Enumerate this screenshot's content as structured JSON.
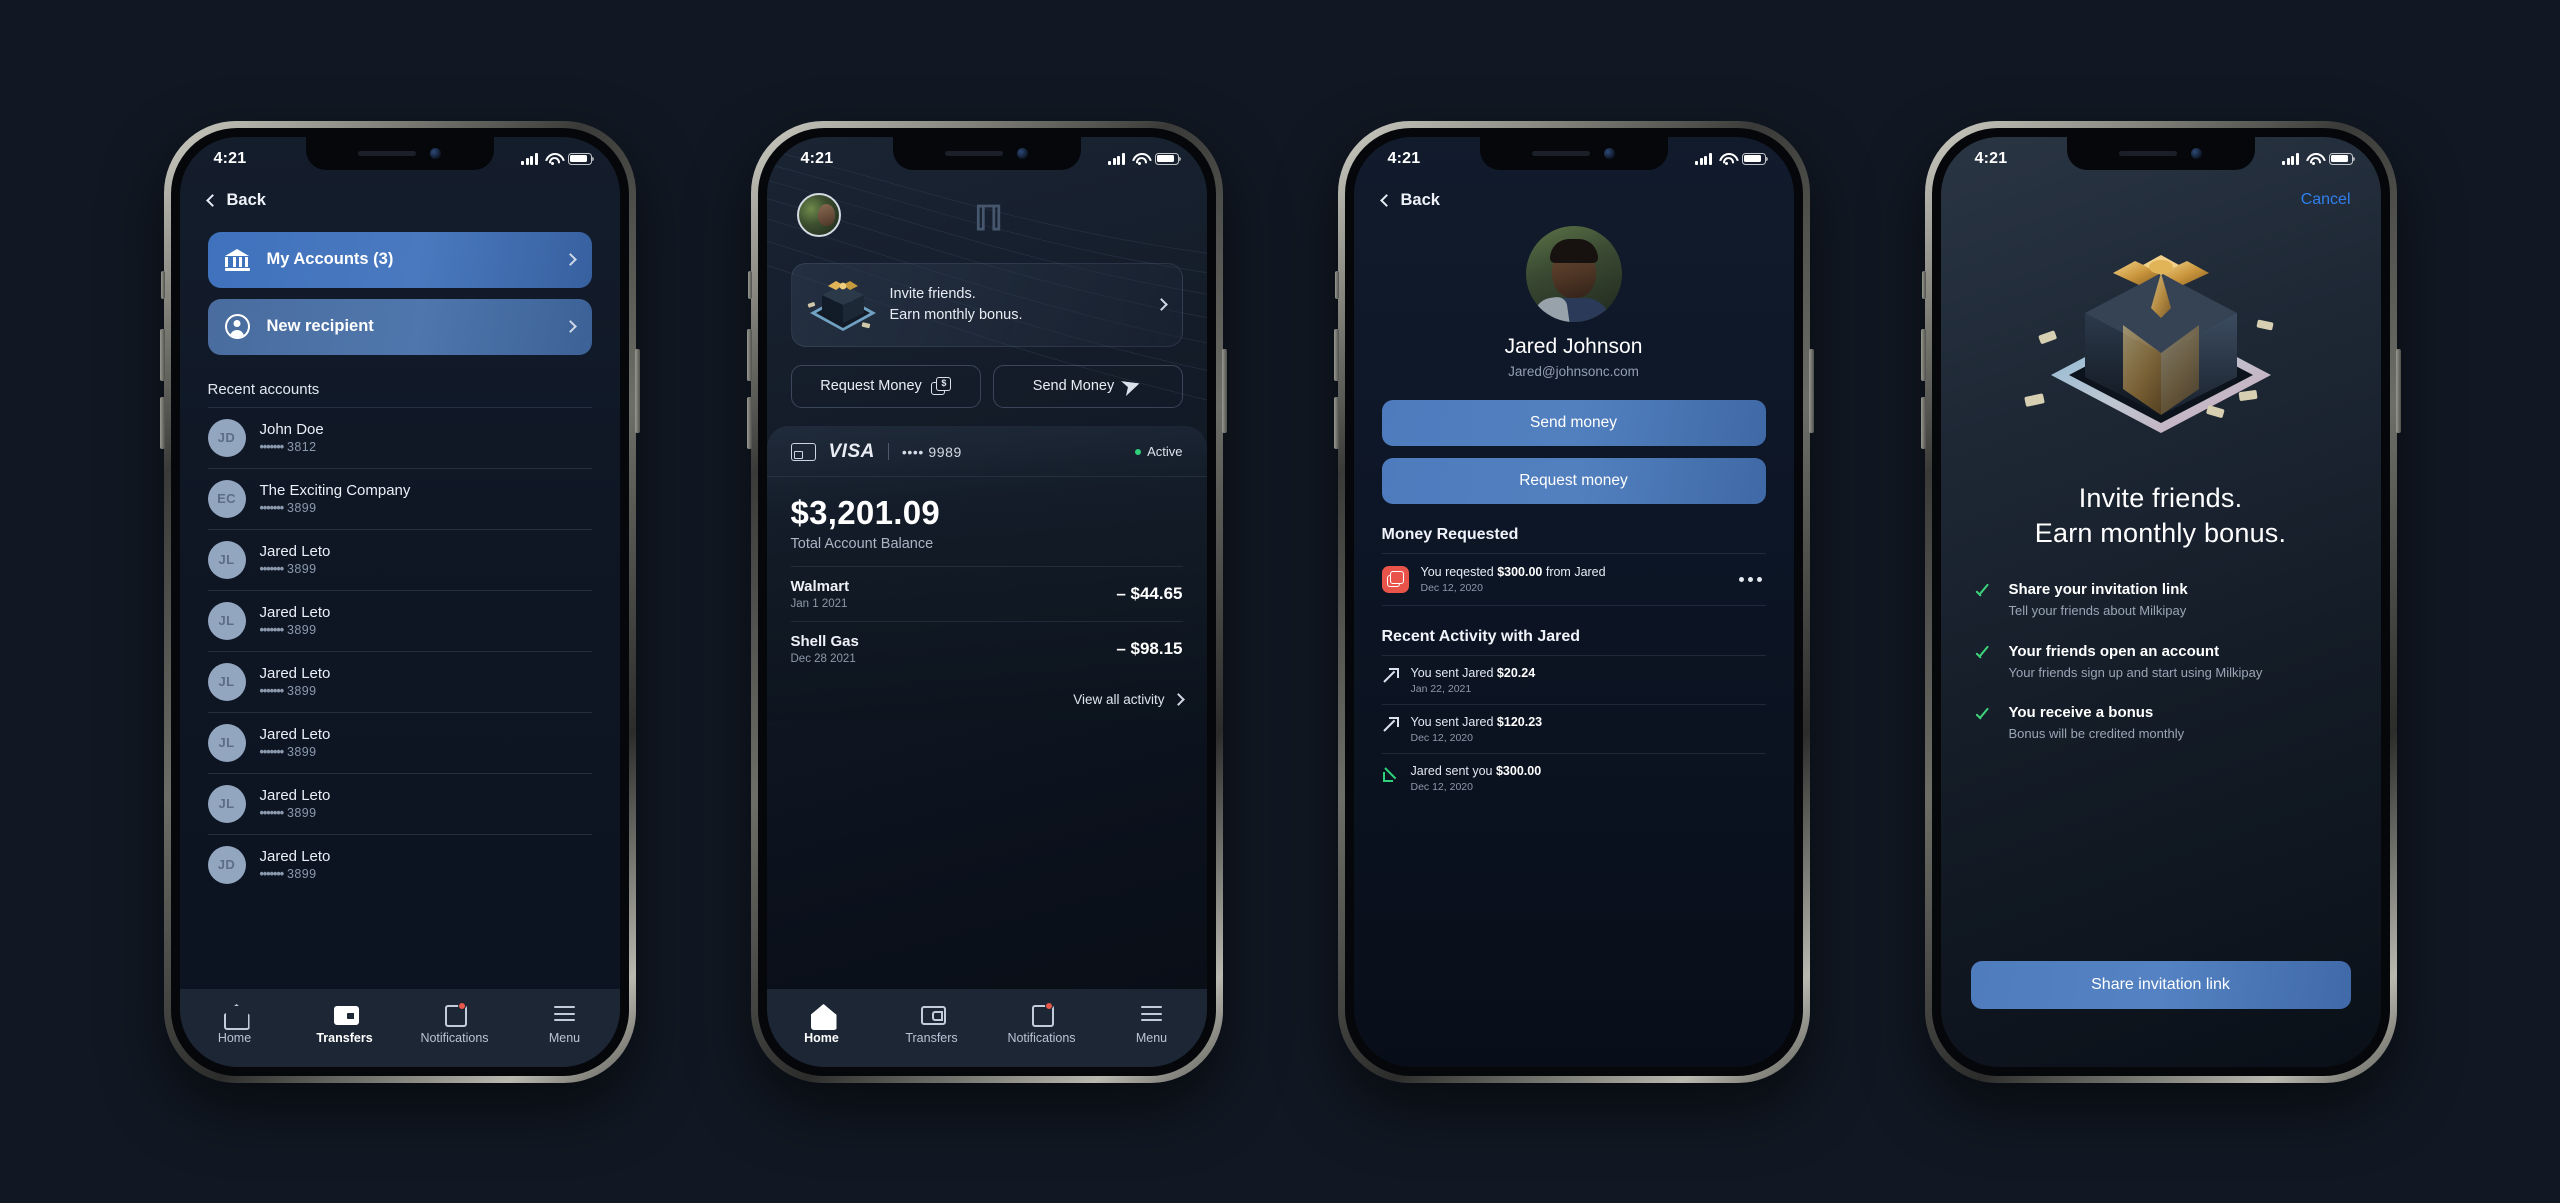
{
  "statusbar": {
    "time": "4:21"
  },
  "phone1": {
    "back_label": "Back",
    "actions": [
      {
        "label": "My Accounts (3)",
        "icon": "bank-icon"
      },
      {
        "label": "New recipient",
        "icon": "person-circle-icon"
      }
    ],
    "section_title": "Recent accounts",
    "accounts": [
      {
        "initials": "JD",
        "name": "John Doe",
        "mask": "•••••••",
        "last4": "3812"
      },
      {
        "initials": "EC",
        "name": "The Exciting Company",
        "mask": "•••••••",
        "last4": "3899"
      },
      {
        "initials": "JL",
        "name": "Jared Leto",
        "mask": "•••••••",
        "last4": "3899"
      },
      {
        "initials": "JL",
        "name": "Jared Leto",
        "mask": "•••••••",
        "last4": "3899"
      },
      {
        "initials": "JL",
        "name": "Jared Leto",
        "mask": "•••••••",
        "last4": "3899"
      },
      {
        "initials": "JL",
        "name": "Jared Leto",
        "mask": "•••••••",
        "last4": "3899"
      },
      {
        "initials": "JL",
        "name": "Jared Leto",
        "mask": "•••••••",
        "last4": "3899"
      },
      {
        "initials": "JD",
        "name": "Jared Leto",
        "mask": "•••••••",
        "last4": "3899"
      }
    ],
    "tabs": [
      {
        "label": "Home",
        "icon": "home-icon"
      },
      {
        "label": "Transfers",
        "icon": "wallet-icon"
      },
      {
        "label": "Notifications",
        "icon": "notifications-icon"
      },
      {
        "label": "Menu",
        "icon": "hamburger-menu-icon"
      }
    ],
    "active_tab": "Transfers"
  },
  "phone2": {
    "brand": "milkipay-logo",
    "invite_card": {
      "line1": "Invite friends.",
      "line2": "Earn monthly bonus."
    },
    "buttons": [
      {
        "label": "Request Money",
        "icon": "request-money-icon"
      },
      {
        "label": "Send Money",
        "icon": "send-money-icon"
      }
    ],
    "card": {
      "network": "VISA",
      "number": "•••• 9989",
      "status": "Active",
      "status_color": "#2fd07a"
    },
    "balance": {
      "amount": "$3,201.09",
      "label": "Total Account Balance"
    },
    "transactions": [
      {
        "name": "Walmart",
        "date": "Jan 1 2021",
        "amount": "– $44.65"
      },
      {
        "name": "Shell Gas",
        "date": "Dec 28 2021",
        "amount": "– $98.15"
      }
    ],
    "view_all": "View all activity",
    "tabs": [
      {
        "label": "Home",
        "icon": "home-icon"
      },
      {
        "label": "Transfers",
        "icon": "wallet-icon"
      },
      {
        "label": "Notifications",
        "icon": "notifications-icon"
      },
      {
        "label": "Menu",
        "icon": "hamburger-menu-icon"
      }
    ],
    "active_tab": "Home"
  },
  "phone3": {
    "back_label": "Back",
    "profile": {
      "name": "Jared Johnson",
      "email": "Jared@johnsonc.com"
    },
    "buttons": [
      "Send money",
      "Request money"
    ],
    "requested_title": "Money Requested",
    "requested": {
      "prefix": "You reqested ",
      "amount": "$300.00",
      "suffix": " from Jared",
      "date": "Dec 12, 2020"
    },
    "activity_title": "Recent Activity with Jared",
    "activity": [
      {
        "prefix": "You sent Jared ",
        "amount": "$20.24",
        "date": "Jan 22, 2021",
        "direction": "out"
      },
      {
        "prefix": "You sent Jared ",
        "amount": "$120.23",
        "date": "Dec 12, 2020",
        "direction": "out"
      },
      {
        "prefix": "Jared sent you ",
        "amount": "$300.00",
        "date": "Dec 12, 2020",
        "direction": "in"
      }
    ]
  },
  "phone4": {
    "cancel_label": "Cancel",
    "title_line1": "Invite friends.",
    "title_line2": "Earn monthly bonus.",
    "features": [
      {
        "title": "Share your invitation link",
        "sub": "Tell your friends about Milkipay"
      },
      {
        "title": "Your friends open an account",
        "sub": "Your friends sign up and start using Milkipay"
      },
      {
        "title": "You receive a bonus",
        "sub": "Bonus will be credited monthly"
      }
    ],
    "cta_label": "Share invitation link"
  }
}
